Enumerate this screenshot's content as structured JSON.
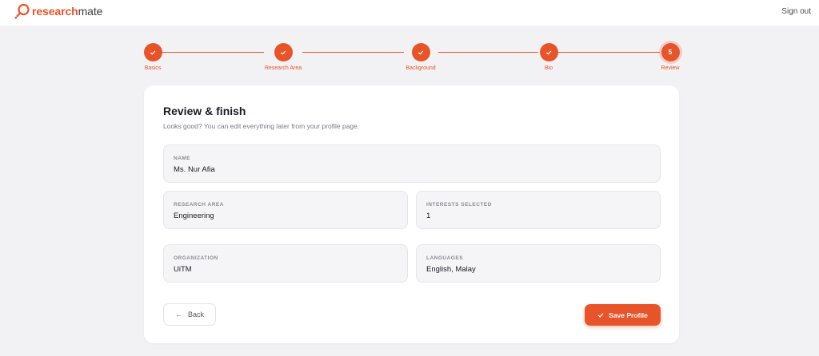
{
  "app": {
    "logo_bold": "research",
    "logo_light": "mate",
    "signout_label": "Sign out"
  },
  "stepper": {
    "steps": [
      {
        "label": "Basics",
        "state": "done"
      },
      {
        "label": "Research Area",
        "state": "done"
      },
      {
        "label": "Background",
        "state": "done"
      },
      {
        "label": "Bio",
        "state": "done"
      },
      {
        "label": "Review",
        "state": "current",
        "number": "5"
      }
    ]
  },
  "card": {
    "title": "Review & finish",
    "subtitle": "Looks good? You can edit everything later from your profile page.",
    "fields": {
      "name": {
        "label": "NAME",
        "value": "Ms. Nur Afia"
      },
      "research_area": {
        "label": "RESEARCH AREA",
        "value": "Engineering"
      },
      "interests": {
        "label": "INTERESTS SELECTED",
        "value": "1"
      },
      "organization": {
        "label": "ORGANIZATION",
        "value": "UiTM"
      },
      "languages": {
        "label": "LANGUAGES",
        "value": "English, Malay"
      }
    },
    "back_label": "Back",
    "save_label": "Save Profile"
  },
  "colors": {
    "accent": "#e8542a",
    "background": "#f2f1f4",
    "card": "#ffffff"
  }
}
